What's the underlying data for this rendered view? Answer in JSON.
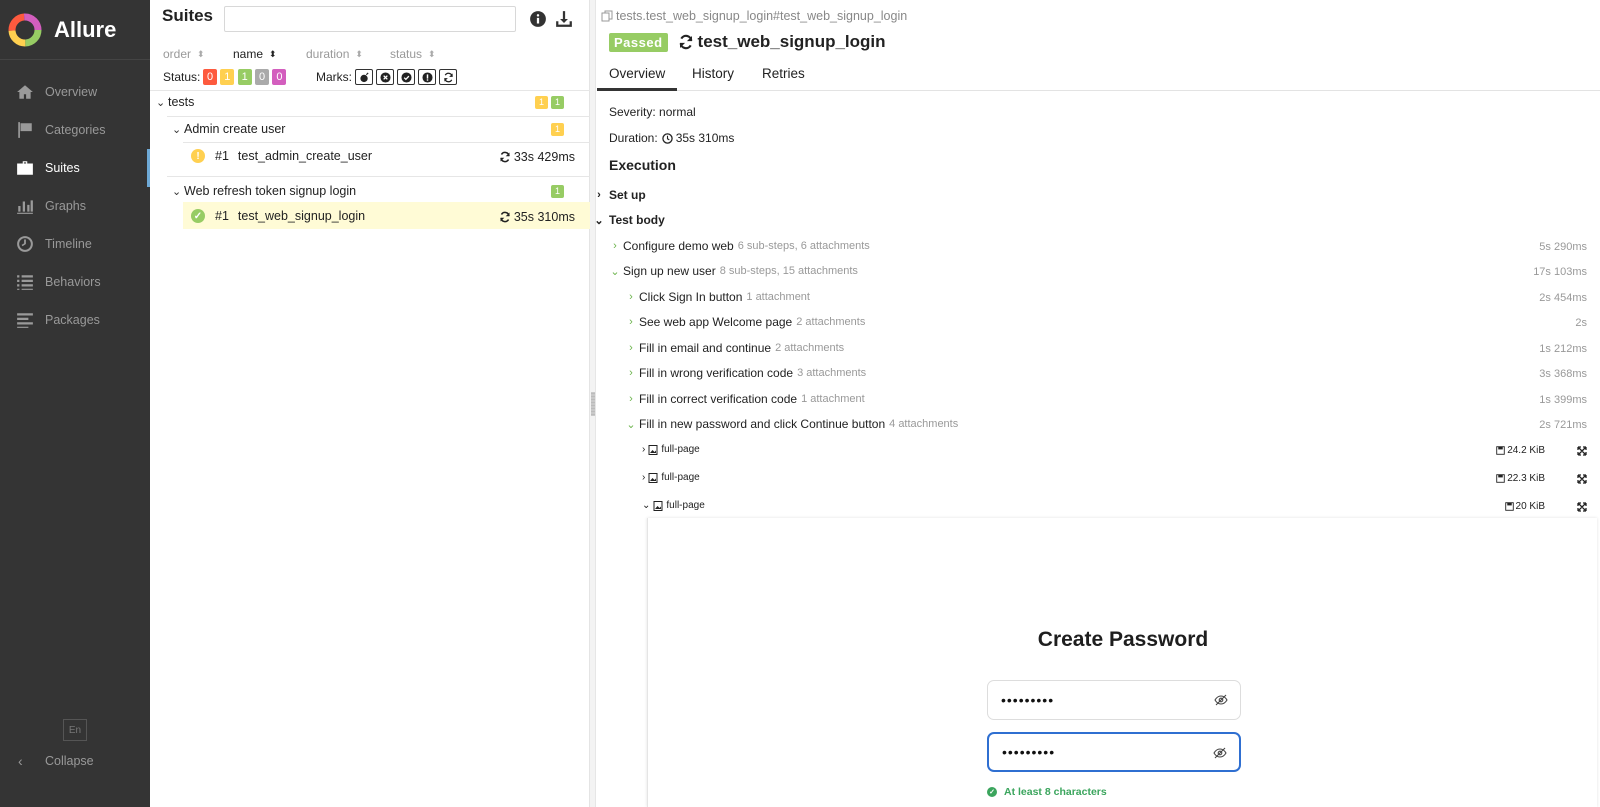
{
  "app": {
    "name": "Allure",
    "lang": "En",
    "collapse_label": "Collapse"
  },
  "nav": [
    {
      "label": "Overview",
      "icon": "home-icon"
    },
    {
      "label": "Categories",
      "icon": "flag-icon"
    },
    {
      "label": "Suites",
      "icon": "briefcase-icon",
      "active": true
    },
    {
      "label": "Graphs",
      "icon": "bar-chart-icon"
    },
    {
      "label": "Timeline",
      "icon": "clock-icon"
    },
    {
      "label": "Behaviors",
      "icon": "list-icon"
    },
    {
      "label": "Packages",
      "icon": "align-left-icon"
    }
  ],
  "suites": {
    "title": "Suites",
    "search_placeholder": "",
    "sort": {
      "order": "order",
      "name": "name",
      "duration": "duration",
      "status": "status"
    },
    "status_label": "Status:",
    "status_counts": [
      {
        "value": "0",
        "color": "#fd5a3e"
      },
      {
        "value": "1",
        "color": "#ffd050"
      },
      {
        "value": "1",
        "color": "#97cc64"
      },
      {
        "value": "0",
        "color": "#aaaaaa"
      },
      {
        "value": "0",
        "color": "#d35ebe"
      }
    ],
    "marks_label": "Marks:",
    "marks": [
      "bomb-icon",
      "times-circle-icon",
      "check-circle-icon",
      "exclamation-circle-icon",
      "refresh-icon"
    ],
    "tree": {
      "root": {
        "name": "tests",
        "broken": "1",
        "passed": "1"
      },
      "groups": [
        {
          "name": "Admin create user",
          "count": "1",
          "count_color": "#ffd050",
          "test": {
            "num": "#1",
            "name": "test_admin_create_user",
            "duration": "33s 429ms",
            "status": "broken",
            "status_color": "#ffd050"
          }
        },
        {
          "name": "Web refresh token signup login",
          "count": "1",
          "count_color": "#97cc64",
          "test": {
            "num": "#1",
            "name": "test_web_signup_login",
            "duration": "35s 310ms",
            "status": "passed",
            "status_color": "#97cc64"
          }
        }
      ]
    }
  },
  "result": {
    "breadcrumb": "tests.test_web_signup_login#test_web_signup_login",
    "status": "Passed",
    "title": "test_web_signup_login",
    "tabs": [
      "Overview",
      "History",
      "Retries"
    ],
    "severity": "Severity: normal",
    "duration_label": "Duration:",
    "duration_value": "35s 310ms",
    "execution_title": "Execution",
    "setup_label": "Set up",
    "test_body_label": "Test body",
    "steps": [
      {
        "name": "Configure demo web",
        "meta": "6 sub-steps, 6 attachments",
        "time": "5s 290ms"
      },
      {
        "name": "Sign up new user",
        "meta": "8 sub-steps, 15 attachments",
        "time": "17s 103ms"
      }
    ],
    "substeps": [
      {
        "name": "Click Sign In button",
        "meta": "1 attachment",
        "time": "2s 454ms"
      },
      {
        "name": "See web app Welcome page",
        "meta": "2 attachments",
        "time": "2s"
      },
      {
        "name": "Fill in email and continue",
        "meta": "2 attachments",
        "time": "1s 212ms"
      },
      {
        "name": "Fill in wrong verification code",
        "meta": "3 attachments",
        "time": "3s 368ms"
      },
      {
        "name": "Fill in correct verification code",
        "meta": "1 attachment",
        "time": "1s 399ms"
      },
      {
        "name": "Fill in new password and click Continue button",
        "meta": "4 attachments",
        "time": "2s 721ms"
      }
    ],
    "attachments": [
      {
        "name": "full-page",
        "size": "24.2 KiB"
      },
      {
        "name": "full-page",
        "size": "22.3 KiB"
      },
      {
        "name": "full-page",
        "size": "20 KiB"
      }
    ]
  },
  "embed": {
    "title": "Create Password",
    "password_value": "•••••••••",
    "confirm_value": "•••••••••",
    "hint": "At least 8 characters"
  }
}
